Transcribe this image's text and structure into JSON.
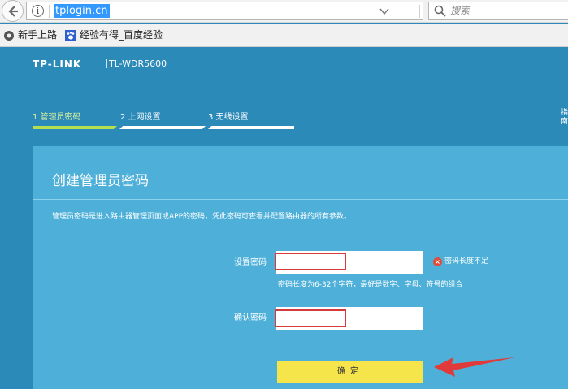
{
  "browser": {
    "url": "tplogin.cn",
    "search_placeholder": "搜索",
    "bookmarks": [
      {
        "label": "新手上路"
      },
      {
        "label": "经验有得_百度经验"
      }
    ]
  },
  "router": {
    "brand": "TP-LINK",
    "model": "TL-WDR5600",
    "steps": [
      {
        "label": "1 管理员密码",
        "active": true
      },
      {
        "label": "2 上网设置",
        "active": false
      },
      {
        "label": "3 无线设置",
        "active": false
      }
    ],
    "edge_text": "指南"
  },
  "form": {
    "title": "创建管理员密码",
    "description": "管理员密码是进入路由器管理页面或APP的密码，凭此密码可查看并配置路由器的所有参数。",
    "password_label": "设置密码",
    "password_value": "",
    "password_error": "密码长度不足",
    "password_hint": "密码长度为6-32个字符，最好是数字、字母、符号的组合",
    "confirm_label": "确认密码",
    "confirm_value": "",
    "submit_label": "确定"
  },
  "colors": {
    "page_bg": "#2b8ab8",
    "panel_bg": "#4eb0d9",
    "active_step": "#b4e04f",
    "submit_bg": "#f5e54b",
    "annotation_red": "#d43b3b"
  }
}
